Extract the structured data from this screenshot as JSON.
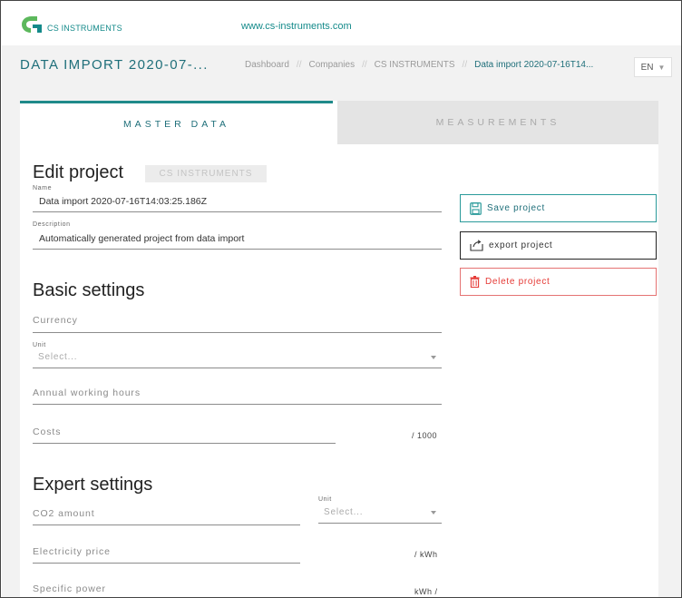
{
  "topbar": {
    "logo_text": "CS INSTRUMENTS",
    "site_link": "www.cs-instruments.com"
  },
  "header": {
    "title": "DATA IMPORT 2020-07-...",
    "breadcrumb": [
      "Dashboard",
      "Companies",
      "CS INSTRUMENTS",
      "Data import 2020-07-16T14..."
    ],
    "breadcrumb_separator": "//",
    "language": "EN"
  },
  "tabs": [
    {
      "label": "MASTER DATA",
      "active": true
    },
    {
      "label": "MEASUREMENTS",
      "active": false
    }
  ],
  "edit_project": {
    "title": "Edit project",
    "company_badge": "CS INSTRUMENTS",
    "name_label": "Name",
    "name_value": "Data import 2020-07-16T14:03:25.186Z",
    "description_label": "Description",
    "description_value": "Automatically generated project from data import"
  },
  "basic_settings": {
    "title": "Basic settings",
    "currency_placeholder": "Currency",
    "unit_label": "Unit",
    "unit_placeholder": "Select...",
    "annual_hours_placeholder": "Annual working hours",
    "costs_placeholder": "Costs",
    "costs_suffix": "/ 1000"
  },
  "expert_settings": {
    "title": "Expert settings",
    "co2_placeholder": "CO2 amount",
    "unit_label": "Unit",
    "unit_placeholder": "Select...",
    "electricity_placeholder": "Electricity price",
    "electricity_suffix": "/ kWh",
    "specific_power_placeholder": "Specific power",
    "specific_power_suffix": "kWh /"
  },
  "actions": {
    "save_label": "Save project",
    "export_label": "export project",
    "delete_label": "Delete project"
  },
  "colors": {
    "brand_teal": "#1f6f7a",
    "accent_teal": "#2a9a9a",
    "danger": "#e53935",
    "logo_green": "#5cb85c"
  }
}
